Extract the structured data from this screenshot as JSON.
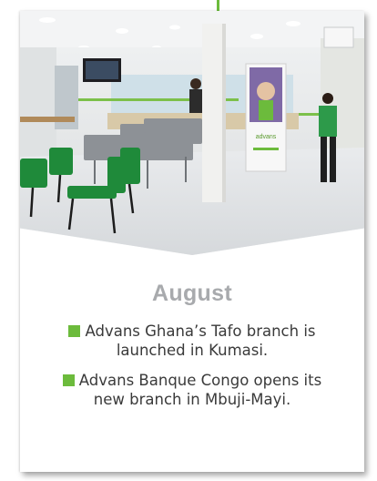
{
  "timeline": {
    "month": "August",
    "items": [
      {
        "text": "Advans Ghana’s Tafo branch is launched in Kumasi."
      },
      {
        "text": "Advans Banque Congo opens its new branch in Mbuji-Mayi."
      }
    ]
  },
  "photo": {
    "scene": "branch-interior",
    "banner_logo_text": "advans"
  },
  "colors": {
    "accent_green": "#6cbb3c",
    "month_gray": "#a8aaad",
    "body_text": "#3a3a3a",
    "chair_green": "#1f8a3a"
  }
}
